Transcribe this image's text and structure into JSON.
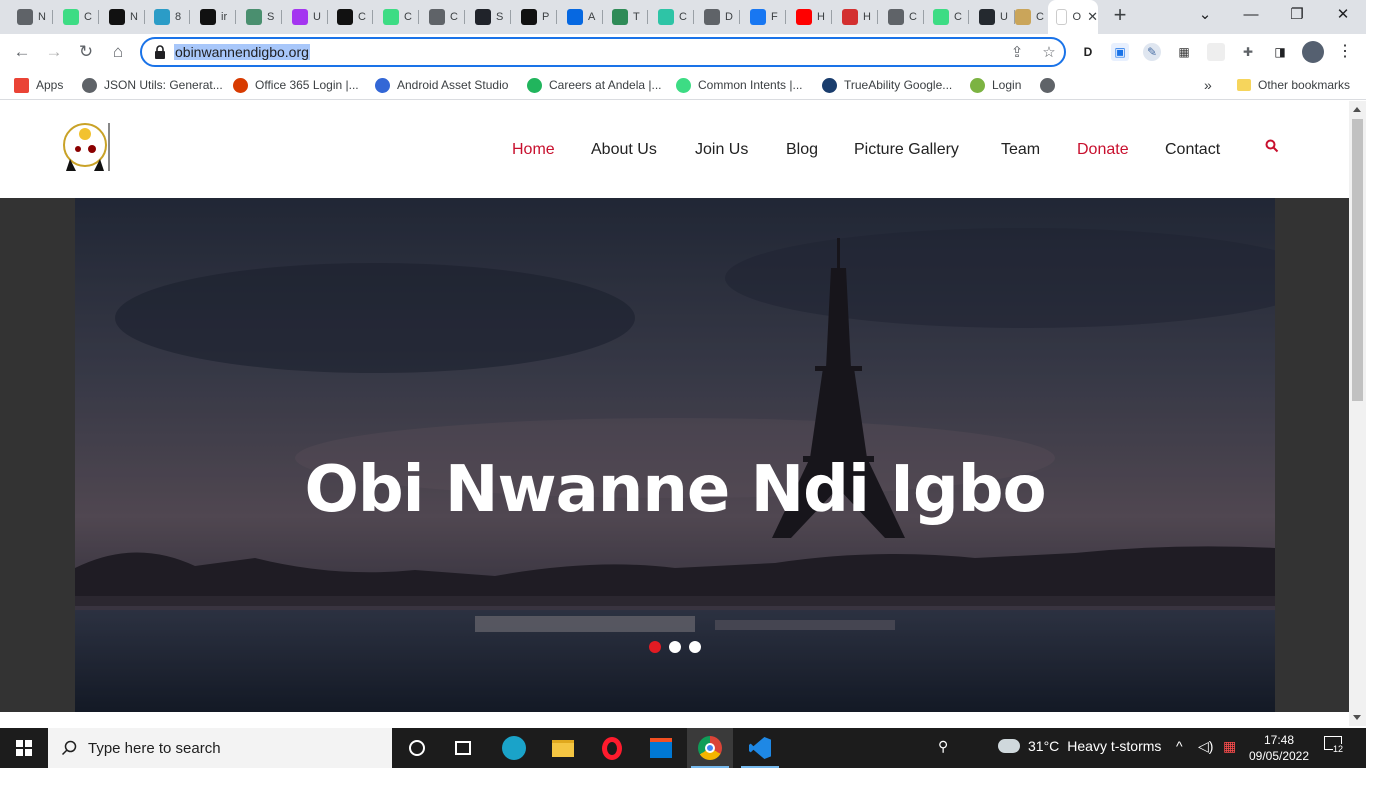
{
  "browser": {
    "tabs": [
      {
        "title": "N",
        "favicon": "chrome-icon",
        "color": "#5f6368"
      },
      {
        "title": "C",
        "favicon": "android-studio-icon",
        "color": "#3ddc84"
      },
      {
        "title": "N",
        "favicon": "hashnode-icon",
        "color": "#111111"
      },
      {
        "title": "8",
        "favicon": "codepen-icon",
        "color": "#2b9cc7"
      },
      {
        "title": "ir",
        "favicon": "ir-icon",
        "color": "#111111"
      },
      {
        "title": "S",
        "favicon": "sparkle-icon",
        "color": "#4a8f6f"
      },
      {
        "title": "U",
        "favicon": "udemy-icon",
        "color": "#a435f0"
      },
      {
        "title": "C",
        "favicon": "hashnode-icon",
        "color": "#111111"
      },
      {
        "title": "C",
        "favicon": "android-studio-icon",
        "color": "#3ddc84"
      },
      {
        "title": "C",
        "favicon": "globe-icon",
        "color": "#5f6368"
      },
      {
        "title": "S",
        "favicon": "react-icon",
        "color": "#20232a"
      },
      {
        "title": "P",
        "favicon": "medium-icon",
        "color": "#111111"
      },
      {
        "title": "A",
        "favicon": "meta-icon",
        "color": "#0668e1"
      },
      {
        "title": "T",
        "favicon": "arrow-icon",
        "color": "#2e8b57"
      },
      {
        "title": "C",
        "favicon": "infinity-icon",
        "color": "#2ec4a6"
      },
      {
        "title": "D",
        "favicon": "globe-icon",
        "color": "#5f6368"
      },
      {
        "title": "F",
        "favicon": "facebook-icon",
        "color": "#1877f2"
      },
      {
        "title": "H",
        "favicon": "youtube-icon",
        "color": "#ff0000"
      },
      {
        "title": "H",
        "favicon": "msu-icon",
        "color": "#d32f2f"
      },
      {
        "title": "C",
        "favicon": "globe-icon",
        "color": "#5f6368"
      },
      {
        "title": "C",
        "favicon": "android-studio-icon",
        "color": "#3ddc84"
      },
      {
        "title": "U",
        "favicon": "github-icon",
        "color": "#24292f"
      },
      {
        "title": "C",
        "favicon": "figure-icon",
        "color": "#caa55a"
      }
    ],
    "active_tab": {
      "title": "O",
      "close": "✕"
    },
    "new_tab": "+",
    "url": "obinwannendigbo.org",
    "bookmarks": [
      {
        "label": "Apps",
        "icon": "apps-grid-icon",
        "color": "#ea4335"
      },
      {
        "label": "JSON Utils: Generat...",
        "icon": "globe-icon",
        "color": "#5f6368"
      },
      {
        "label": "Office 365 Login |...",
        "icon": "office-icon",
        "color": "#d83b01"
      },
      {
        "label": "Android Asset Studio",
        "icon": "compass-icon",
        "color": "#3367d6"
      },
      {
        "label": "Careers at Andela |...",
        "icon": "andela-icon",
        "color": "#21b55d"
      },
      {
        "label": "Common Intents   |...",
        "icon": "android-icon",
        "color": "#3ddc84"
      },
      {
        "label": "TrueAbility Google...",
        "icon": "shield-icon",
        "color": "#1a3d6d"
      },
      {
        "label": "Login",
        "icon": "login-icon",
        "color": "#7cb342"
      }
    ],
    "more_bookmarks": "»",
    "other_bookmarks": "Other bookmarks"
  },
  "site": {
    "nav": [
      {
        "label": "Home",
        "highlight": true
      },
      {
        "label": "About Us",
        "highlight": false
      },
      {
        "label": "Join Us",
        "highlight": false
      },
      {
        "label": "Blog",
        "highlight": false
      },
      {
        "label": "Picture Gallery",
        "highlight": false
      },
      {
        "label": "Team",
        "highlight": false
      },
      {
        "label": "Donate",
        "highlight": true
      },
      {
        "label": "Contact",
        "highlight": false
      }
    ],
    "accent": "#c8102e",
    "hero": {
      "title": "Obi Nwanne Ndi Igbo",
      "slides": 3,
      "active_slide": 1
    }
  },
  "taskbar": {
    "search_placeholder": "Type here to search",
    "weather": {
      "temp": "31°C",
      "condition": "Heavy t-storms"
    },
    "time": "17:48",
    "date": "09/05/2022",
    "notifications": "12"
  }
}
